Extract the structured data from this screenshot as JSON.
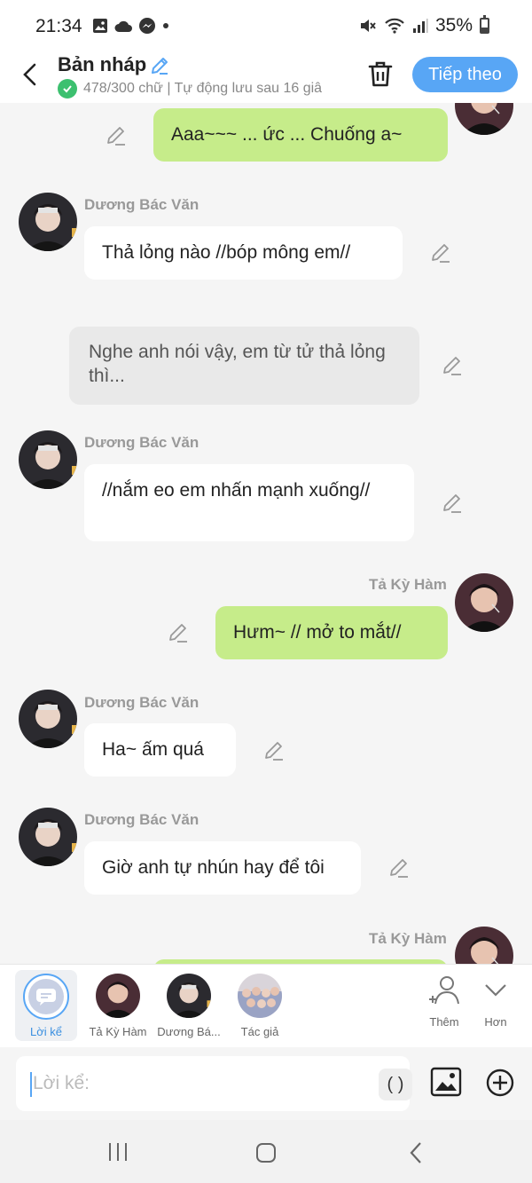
{
  "status_bar": {
    "time": "21:34",
    "battery": "35%",
    "battery_level": 0.35,
    "icons_left": [
      "gallery-icon",
      "cloud-icon",
      "messenger-icon",
      "dot-icon"
    ],
    "icons_right": [
      "mute-icon",
      "wifi-icon",
      "signal-icon",
      "battery-icon"
    ]
  },
  "header": {
    "title": "Bản nháp",
    "subtitle": "478/300 chữ | Tự động lưu sau 16 giâ",
    "next_label": "Tiếp theo"
  },
  "messages": [
    {
      "speaker": "",
      "text": "Aaa~~~ ... ức ... Chuống a~",
      "style": "green",
      "side": "right"
    },
    {
      "speaker": "Dương Bác Văn",
      "text": "Thả lỏng nào //bóp mông em//",
      "style": "white",
      "side": "left"
    },
    {
      "speaker": "",
      "text": "Nghe anh nói vậy, em từ tử thả lỏng thì...",
      "style": "gray",
      "side": "narration"
    },
    {
      "speaker": "Dương Bác Văn",
      "text": "//nắm eo em nhấn mạnh xuống//",
      "style": "white",
      "side": "left"
    },
    {
      "speaker": "Tả Kỳ Hàm",
      "text": "Hưm~ // mở to mắt//",
      "style": "green",
      "side": "right"
    },
    {
      "speaker": "Dương Bác Văn",
      "text": "Ha~ ấm quá",
      "style": "white",
      "side": "left"
    },
    {
      "speaker": "Dương Bác Văn",
      "text": "Giờ anh tự nhún hay để tôi",
      "style": "white",
      "side": "left"
    },
    {
      "speaker": "Tả Kỳ Hàm",
      "text": "",
      "style": "green",
      "side": "right"
    }
  ],
  "characters": [
    {
      "label": "Lời kể",
      "selected": true
    },
    {
      "label": "Tả Kỳ Hàm",
      "selected": false
    },
    {
      "label": "Dương Bá...",
      "selected": false
    },
    {
      "label": "Tác giả",
      "selected": false
    }
  ],
  "tools": {
    "add_label": "Thêm",
    "more_label": "Hơn"
  },
  "input": {
    "placeholder": "Lời kể:",
    "paren_label": "( )"
  },
  "colors": {
    "accent": "#58a6f5",
    "green_bubble": "#c6ec8a",
    "check": "#3cc06f"
  }
}
